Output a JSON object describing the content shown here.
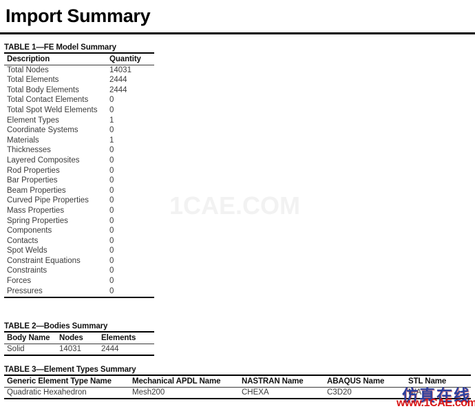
{
  "document": {
    "title": "Import Summary"
  },
  "table1": {
    "caption": "TABLE 1—FE Model Summary",
    "columns": [
      "Description",
      "Quantity"
    ],
    "rows": [
      [
        "Total Nodes",
        "14031"
      ],
      [
        "Total Elements",
        "2444"
      ],
      [
        "Total Body Elements",
        "2444"
      ],
      [
        "Total Contact Elements",
        "0"
      ],
      [
        "Total Spot Weld Elements",
        "0"
      ],
      [
        "Element Types",
        "1"
      ],
      [
        "Coordinate Systems",
        "0"
      ],
      [
        "Materials",
        "1"
      ],
      [
        "Thicknesses",
        "0"
      ],
      [
        "Layered Composites",
        "0"
      ],
      [
        "Rod Properties",
        "0"
      ],
      [
        "Bar Properties",
        "0"
      ],
      [
        "Beam Properties",
        "0"
      ],
      [
        "Curved Pipe Properties",
        "0"
      ],
      [
        "Mass Properties",
        "0"
      ],
      [
        "Spring Properties",
        "0"
      ],
      [
        "Components",
        "0"
      ],
      [
        "Contacts",
        "0"
      ],
      [
        "Spot Welds",
        "0"
      ],
      [
        "Constraint Equations",
        "0"
      ],
      [
        "Constraints",
        "0"
      ],
      [
        "Forces",
        "0"
      ],
      [
        "Pressures",
        "0"
      ]
    ]
  },
  "table2": {
    "caption": "TABLE 2—Bodies Summary",
    "columns": [
      "Body Name",
      "Nodes",
      "Elements"
    ],
    "rows": [
      [
        "Solid",
        "14031",
        "2444"
      ]
    ]
  },
  "table3": {
    "caption": "TABLE 3—Element Types Summary",
    "columns": [
      "Generic Element Type Name",
      "Mechanical APDL Name",
      "NASTRAN Name",
      "ABAQUS Name",
      "STL Name"
    ],
    "rows": [
      [
        "Quadratic Hexahedron",
        "Mesh200",
        "CHEXA",
        "C3D20",
        "N/A"
      ]
    ]
  },
  "watermarks": {
    "center": "1CAE.COM",
    "center_color": "#f2f2f2",
    "chinese": "仿真在线",
    "chinese_color": "#2b3f9e",
    "url": "www.1CAE.com",
    "url_color": "#d81616"
  }
}
